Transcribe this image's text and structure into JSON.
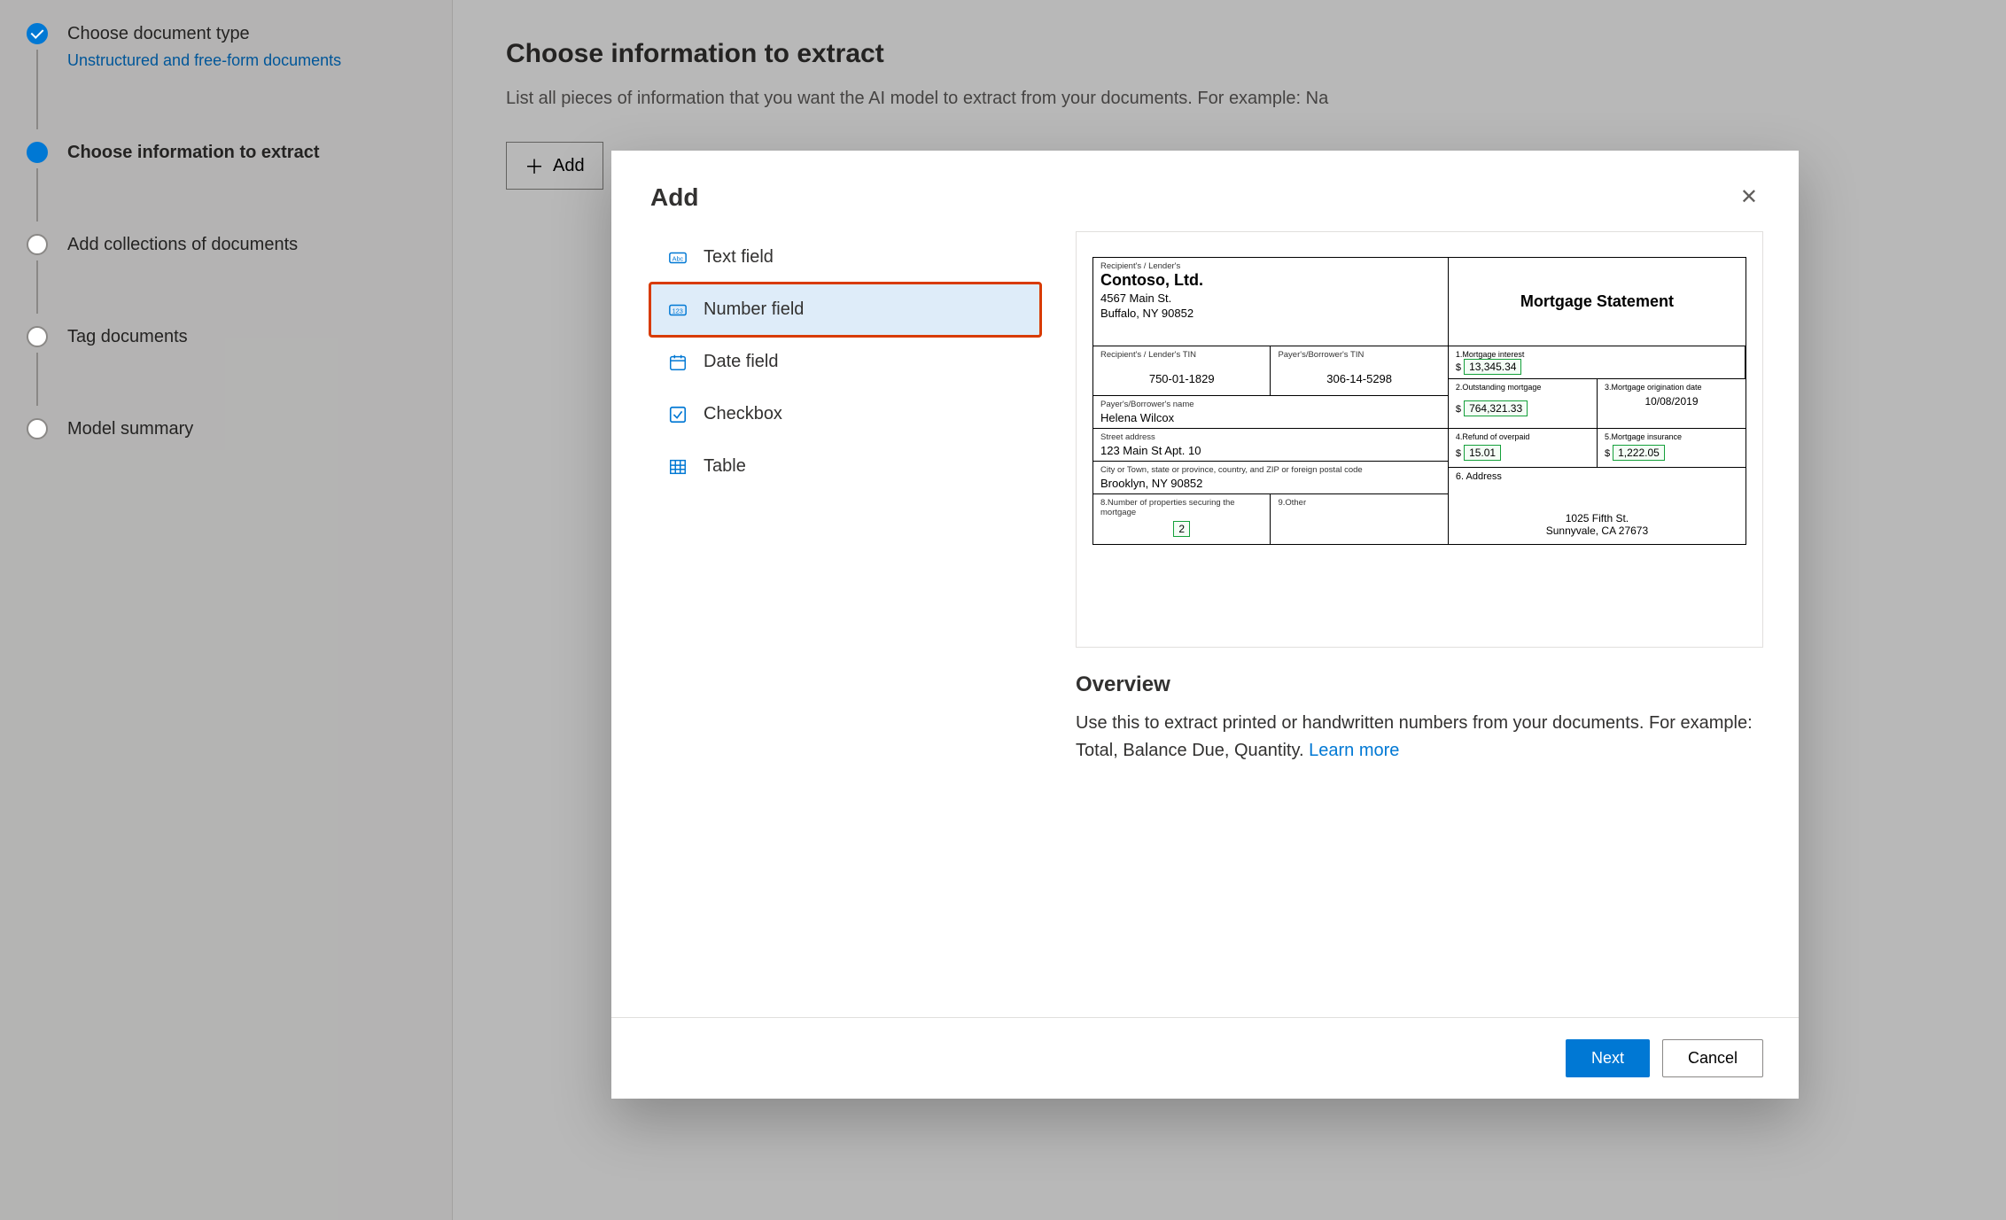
{
  "sidebar": {
    "steps": [
      {
        "title": "Choose document type",
        "sub": "Unstructured and free-form documents",
        "state": "completed"
      },
      {
        "title": "Choose information to extract",
        "state": "active"
      },
      {
        "title": "Add collections of documents",
        "state": "pending"
      },
      {
        "title": "Tag documents",
        "state": "pending"
      },
      {
        "title": "Model summary",
        "state": "pending"
      }
    ]
  },
  "main": {
    "heading": "Choose information to extract",
    "description": "List all pieces of information that you want the AI model to extract from your documents. For example: Na",
    "add_button": "Add"
  },
  "modal": {
    "title": "Add",
    "field_types": [
      {
        "id": "text",
        "label": "Text field"
      },
      {
        "id": "number",
        "label": "Number field",
        "selected": true
      },
      {
        "id": "date",
        "label": "Date field"
      },
      {
        "id": "checkbox",
        "label": "Checkbox"
      },
      {
        "id": "table",
        "label": "Table"
      }
    ],
    "overview_title": "Overview",
    "overview_text": "Use this to extract printed or handwritten numbers from your documents. For example: Total, Balance Due, Quantity. ",
    "learn_more": "Learn more",
    "next": "Next",
    "cancel": "Cancel"
  },
  "document": {
    "lender_label": "Recipient's / Lender's",
    "lender_name": "Contoso, Ltd.",
    "lender_addr1": "4567 Main St.",
    "lender_addr2": "Buffalo, NY 90852",
    "tin_row": {
      "l_label": "Recipient's / Lender's TIN",
      "l_val": "750-01-1829",
      "r_label": "Payer's/Borrower's TIN",
      "r_val": "306-14-5298"
    },
    "borrower_label": "Payer's/Borrower's name",
    "borrower_name": "Helena Wilcox",
    "street_label": "Street address",
    "street": "123 Main St Apt. 10",
    "city_label": "City or Town, state or province, country, and ZIP or foreign postal code",
    "city": "Brooklyn, NY 90852",
    "prop_row": {
      "l_label": "8.Number of properties securing the mortgage",
      "l_val": "2",
      "r_label": "9.Other"
    },
    "title": "Mortgage Statement",
    "r1": {
      "label": "1.Mortgage interest",
      "val": "13,345.34"
    },
    "r2": {
      "l_label": "2.Outstanding mortgage",
      "l_val": "764,321.33",
      "r_label": "3.Mortgage origination date",
      "r_val": "10/08/2019"
    },
    "r3": {
      "l_label": "4.Refund of overpaid",
      "l_val": "15.01",
      "r_label": "5.Mortgage insurance",
      "r_val": "1,222.05"
    },
    "r4_label": "6. Address",
    "r4_addr1": "1025 Fifth St.",
    "r4_addr2": "Sunnyvale, CA 27673"
  }
}
